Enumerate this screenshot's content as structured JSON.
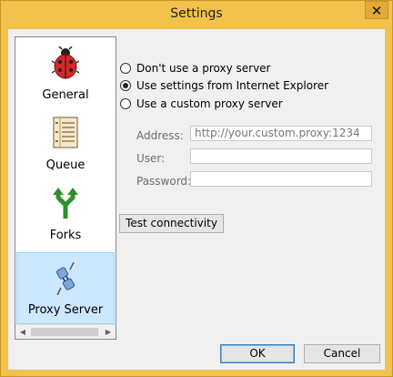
{
  "window": {
    "title": "Settings",
    "close_glyph": "✕"
  },
  "sidebar": {
    "items": [
      {
        "label": "General",
        "icon": "ladybug-icon"
      },
      {
        "label": "Queue",
        "icon": "queue-list-icon"
      },
      {
        "label": "Forks",
        "icon": "fork-arrows-icon"
      },
      {
        "label": "Proxy Server",
        "icon": "network-plug-icon",
        "selected": true
      }
    ],
    "scroll_left_glyph": "◀",
    "scroll_right_glyph": "▶"
  },
  "proxy": {
    "options": [
      {
        "label": "Don't use a proxy server",
        "checked": false
      },
      {
        "label": "Use settings from Internet Explorer",
        "checked": true
      },
      {
        "label": "Use a custom proxy server",
        "checked": false
      }
    ],
    "address_label": "Address:",
    "address_value": "http://your.custom.proxy:1234",
    "user_label": "User:",
    "user_value": "",
    "password_label": "Password:",
    "password_value": "",
    "test_button": "Test connectivity"
  },
  "footer": {
    "ok_label": "OK",
    "cancel_label": "Cancel"
  },
  "colors": {
    "titlebar": "#f2c24c",
    "selected_item": "#cce8ff",
    "accent_border": "#3c7fb1"
  }
}
